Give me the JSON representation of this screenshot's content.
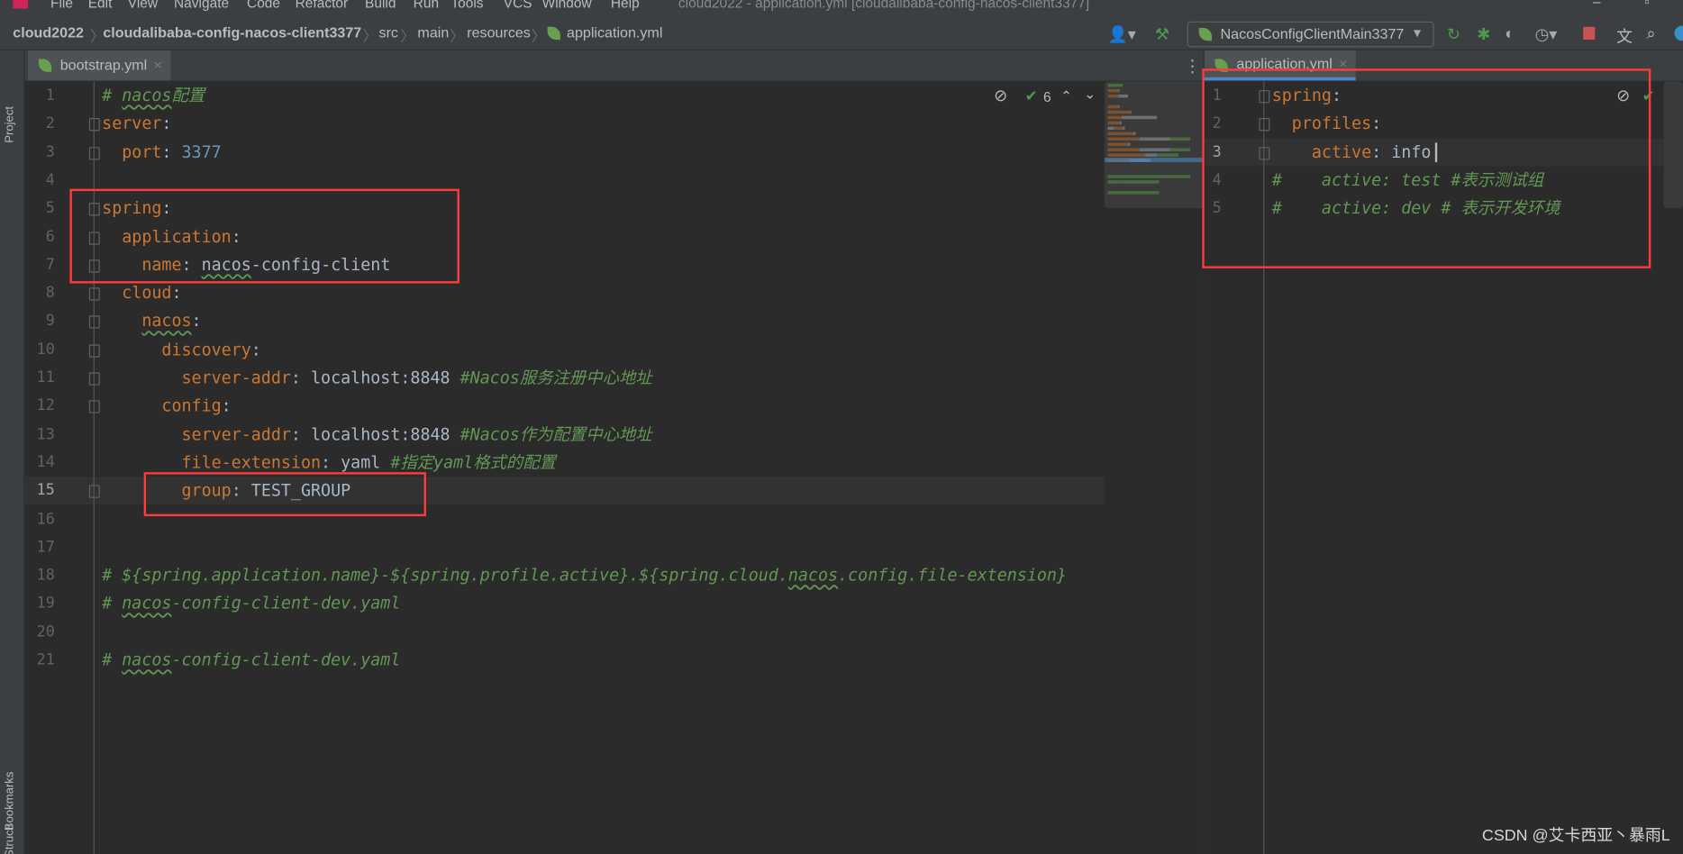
{
  "menu": [
    "File",
    "Edit",
    "View",
    "Navigate",
    "Code",
    "Refactor",
    "Build",
    "Run",
    "Tools",
    "VCS",
    "Window",
    "Help"
  ],
  "window_title": "cloud2022 - application.yml [cloudalibaba-config-nacos-client3377]",
  "breadcrumb": [
    "cloud2022",
    "cloudalibaba-config-nacos-client3377",
    "src",
    "main",
    "resources",
    "application.yml"
  ],
  "run_config": "NacosConfigClientMain3377",
  "toolbar_icons": [
    "user-icon",
    "build-hammer-icon",
    "rerun-icon",
    "debug-icon",
    "coverage-icon",
    "profile-icon",
    "stop-icon",
    "translate-icon",
    "search-icon"
  ],
  "side_tabs": {
    "project": "Project",
    "bookmarks": "Bookmarks",
    "structure": "Structure"
  },
  "left_editor": {
    "tab": "bootstrap.yml",
    "inspection_count": "6",
    "current_line": 15,
    "lines": [
      [
        [
          "# ",
          "c"
        ],
        [
          "nacos",
          "c u"
        ],
        [
          "配置",
          "c"
        ]
      ],
      [
        [
          "server",
          "k"
        ],
        [
          ":",
          "p"
        ]
      ],
      [
        [
          "  port",
          "k"
        ],
        [
          ": ",
          "p"
        ],
        [
          "3377",
          "n"
        ]
      ],
      [],
      [
        [
          "spring",
          "k"
        ],
        [
          ":",
          "p"
        ]
      ],
      [
        [
          "  application",
          "k"
        ],
        [
          ":",
          "p"
        ]
      ],
      [
        [
          "    name",
          "k"
        ],
        [
          ": ",
          "p"
        ],
        [
          "nacos",
          "v u"
        ],
        [
          "-config-client",
          "v"
        ]
      ],
      [
        [
          "  cloud",
          "k"
        ],
        [
          ":",
          "p"
        ]
      ],
      [
        [
          "    ",
          "p"
        ],
        [
          "nacos",
          "k u"
        ],
        [
          ":",
          "p"
        ]
      ],
      [
        [
          "      discovery",
          "k"
        ],
        [
          ":",
          "p"
        ]
      ],
      [
        [
          "        server-addr",
          "k"
        ],
        [
          ": ",
          "p"
        ],
        [
          "localhost:8848 ",
          "v"
        ],
        [
          "#Nacos服务注册中心地址",
          "c"
        ]
      ],
      [
        [
          "      config",
          "k"
        ],
        [
          ":",
          "p"
        ]
      ],
      [
        [
          "        server-addr",
          "k"
        ],
        [
          ": ",
          "p"
        ],
        [
          "localhost:8848 ",
          "v"
        ],
        [
          "#Nacos作为配置中心地址",
          "c"
        ]
      ],
      [
        [
          "        file-extension",
          "k"
        ],
        [
          ": ",
          "p"
        ],
        [
          "yaml ",
          "v"
        ],
        [
          "#指定yaml格式的配置",
          "c"
        ]
      ],
      [
        [
          "        group",
          "k"
        ],
        [
          ": ",
          "p"
        ],
        [
          "TEST_GROUP",
          "v"
        ]
      ],
      [],
      [],
      [
        [
          "# ${spring.application.name}-${spring.profile.active}.${spring.cloud.",
          "c"
        ],
        [
          "nacos",
          "c u"
        ],
        [
          ".config.file-extension}",
          "c"
        ]
      ],
      [
        [
          "# ",
          "c"
        ],
        [
          "nacos",
          "c u"
        ],
        [
          "-config-client-dev.yaml",
          "c"
        ]
      ],
      [],
      [
        [
          "# ",
          "c"
        ],
        [
          "nacos",
          "c u"
        ],
        [
          "-config-client-dev.yaml",
          "c"
        ]
      ]
    ]
  },
  "right_editor": {
    "tab": "application.yml",
    "current_line": 3,
    "lines": [
      [
        [
          "spring",
          "k"
        ],
        [
          ":",
          "p"
        ]
      ],
      [
        [
          "  profiles",
          "k"
        ],
        [
          ":",
          "p"
        ]
      ],
      [
        [
          "    active",
          "k"
        ],
        [
          ": ",
          "p"
        ],
        [
          "info",
          "v"
        ]
      ],
      [
        [
          "#    active: test #表示测试组",
          "c"
        ]
      ],
      [
        [
          "#    active: dev # 表示开发环境",
          "c"
        ]
      ]
    ]
  },
  "watermark": "CSDN @艾卡西亚丶暴雨L",
  "colors": {
    "keyword": "#cc7832",
    "value": "#a9b7c6",
    "number": "#6897bb",
    "comment": "#629755",
    "highlight_box": "#ff3b3b"
  }
}
